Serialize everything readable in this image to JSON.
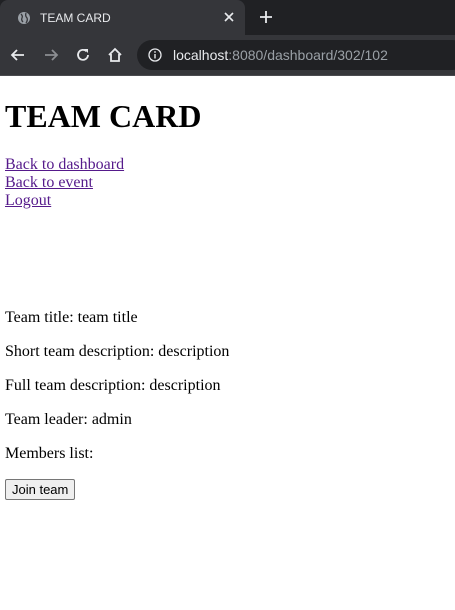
{
  "browser": {
    "tab_title": "TEAM CARD",
    "url_host": "localhost",
    "url_rest": ":8080/dashboard/302/102"
  },
  "page": {
    "title": "TEAM CARD",
    "links": {
      "dashboard": "Back to dashboard",
      "event": "Back to event",
      "logout": "Logout"
    },
    "team": {
      "title": "Team title: team title",
      "short_description": "Short team description: description",
      "full_description": "Full team description: description",
      "leader": "Team leader: admin",
      "members": "Members list:"
    },
    "join_button": "Join team"
  },
  "icons": {
    "tab": "globe-icon",
    "close": "close-icon",
    "new_tab": "plus-icon",
    "back": "arrow-left-icon",
    "forward": "arrow-right-icon",
    "reload": "reload-icon",
    "home": "home-icon",
    "site_info": "info-icon"
  }
}
